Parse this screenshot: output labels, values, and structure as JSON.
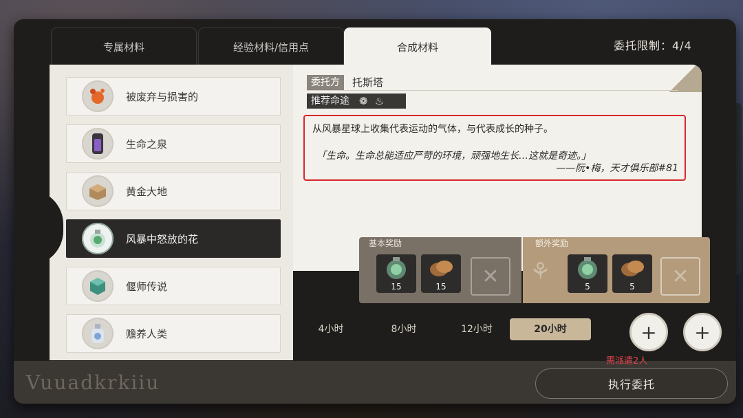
{
  "tabs": [
    {
      "label": "专属材料",
      "active": false
    },
    {
      "label": "经验材料/信用点",
      "active": false
    },
    {
      "label": "合成材料",
      "active": true
    }
  ],
  "limit_text": "委托限制：4/4",
  "items": [
    {
      "label": "被废弃与损害的",
      "icon": "orbs-icon",
      "selected": false
    },
    {
      "label": "生命之泉",
      "icon": "vial-icon",
      "selected": false
    },
    {
      "label": "黄金大地",
      "icon": "box-icon",
      "selected": false
    },
    {
      "label": "风暴中怒放的花",
      "icon": "flask-icon",
      "selected": true
    },
    {
      "label": "偃师传说",
      "icon": "cube-icon",
      "selected": false
    },
    {
      "label": "赡养人类",
      "icon": "bottle-icon",
      "selected": false
    }
  ],
  "detail": {
    "client_label": "委托方",
    "client_name": "托斯塔",
    "path_label": "推荐命途",
    "description": "从风暴星球上收集代表运动的气体，与代表成长的种子。",
    "quote": "「生命。生命总能适应严苛的环境，顽强地生长…这就是奇迹。」",
    "signature": "——阮•梅，天才俱乐部#81"
  },
  "rewards": {
    "basic_title": "基本奖励",
    "extra_title": "额外奖励",
    "basic_items": [
      {
        "icon": "flask-icon",
        "count": "15"
      },
      {
        "icon": "seed-icon",
        "count": "15"
      }
    ],
    "extra_items": [
      {
        "icon": "flask-icon",
        "count": "5"
      },
      {
        "icon": "seed-icon",
        "count": "5"
      }
    ]
  },
  "time_options": [
    {
      "label": "4小时",
      "active": false
    },
    {
      "label": "8小时",
      "active": false
    },
    {
      "label": "12小时",
      "active": false
    },
    {
      "label": "20小时",
      "active": true
    }
  ],
  "need_text": "需派遣2人",
  "execute_label": "执行委托",
  "deco_text": "Vuuadkrkiiu",
  "colors": {
    "accent": "#c9b79a",
    "selected_bg": "#2a2927",
    "highlight_border": "#d6262b",
    "warning": "#e0454d"
  }
}
